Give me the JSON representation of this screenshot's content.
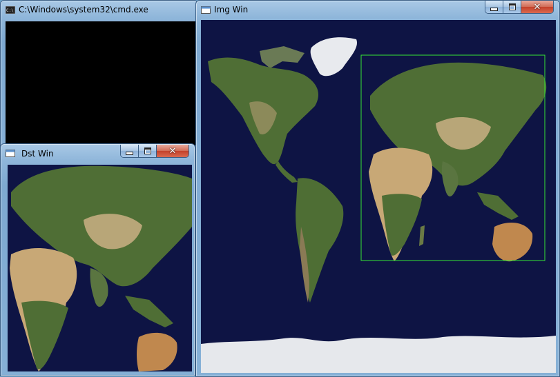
{
  "windows": {
    "cmd": {
      "title": "C:\\Windows\\system32\\cmd.exe",
      "icon": "console-icon"
    },
    "dst": {
      "title": "Dst Win",
      "icon": "window-icon"
    },
    "img": {
      "title": "Img Win",
      "icon": "window-icon"
    }
  },
  "controls": {
    "close_glyph": "✕"
  },
  "colors": {
    "ocean": "#0e1444",
    "land_green": "#4f6e35",
    "land_desert": "#c8a876",
    "ice": "#e6e8ec",
    "selection_rect": "#35e635",
    "console_bg": "#000000"
  }
}
